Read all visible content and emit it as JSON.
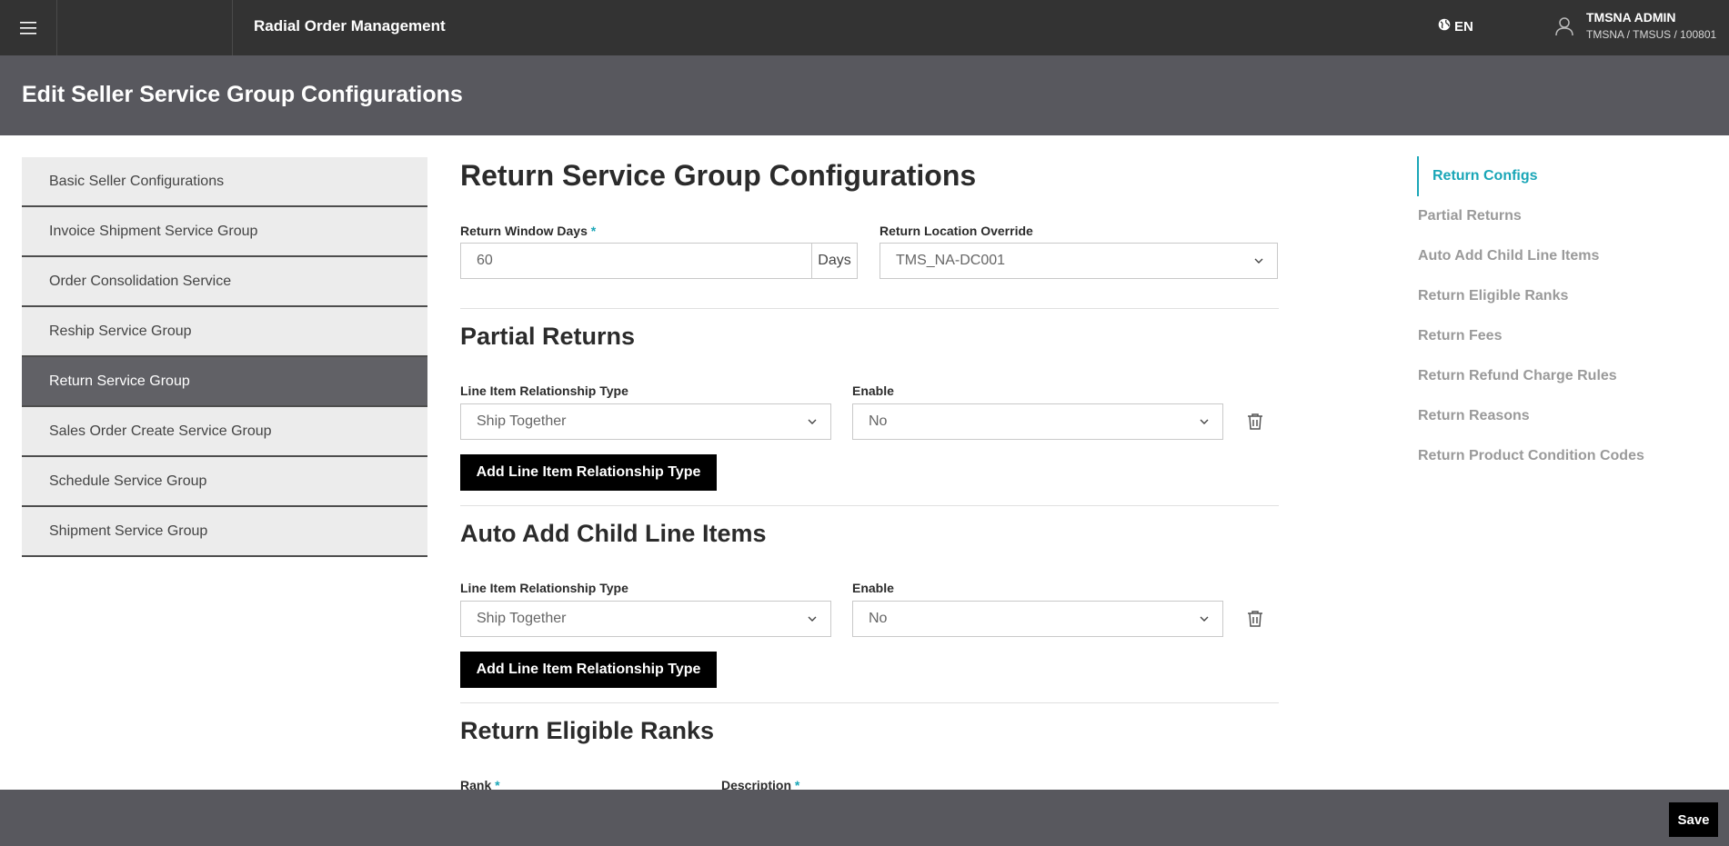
{
  "topbar": {
    "app_title": "Radial Order Management",
    "language": "EN",
    "user_name": "TMSNA ADMIN",
    "user_org": "TMSNA / TMSUS / 100801"
  },
  "page": {
    "title": "Edit Seller Service Group Configurations"
  },
  "leftnav": {
    "items": [
      {
        "label": "Basic Seller Configurations"
      },
      {
        "label": "Invoice Shipment Service Group"
      },
      {
        "label": "Order Consolidation Service"
      },
      {
        "label": "Reship Service Group"
      },
      {
        "label": "Return Service Group",
        "active": true
      },
      {
        "label": "Sales Order Create Service Group"
      },
      {
        "label": "Schedule Service Group"
      },
      {
        "label": "Shipment Service Group"
      }
    ]
  },
  "main": {
    "title": "Return Service Group Configurations",
    "return_window": {
      "label": "Return Window Days",
      "required_mark": "*",
      "value": "60",
      "unit": "Days"
    },
    "return_location": {
      "label": "Return Location Override",
      "value": "TMS_NA-DC001"
    },
    "partial_returns": {
      "title": "Partial Returns",
      "relationship_label": "Line Item Relationship Type",
      "relationship_value": "Ship Together",
      "enable_label": "Enable",
      "enable_value": "No",
      "add_button": "Add Line Item Relationship Type"
    },
    "auto_add": {
      "title": "Auto Add Child Line Items",
      "relationship_label": "Line Item Relationship Type",
      "relationship_value": "Ship Together",
      "enable_label": "Enable",
      "enable_value": "No",
      "add_button": "Add Line Item Relationship Type"
    },
    "eligible_ranks": {
      "title": "Return Eligible Ranks",
      "rank_label": "Rank",
      "description_label": "Description",
      "required_mark": "*"
    }
  },
  "toc": {
    "items": [
      {
        "label": "Return Configs",
        "active": true
      },
      {
        "label": "Partial Returns"
      },
      {
        "label": "Auto Add Child Line Items"
      },
      {
        "label": "Return Eligible Ranks"
      },
      {
        "label": "Return Fees"
      },
      {
        "label": "Return Refund Charge Rules"
      },
      {
        "label": "Return Reasons"
      },
      {
        "label": "Return Product Condition Codes"
      }
    ]
  },
  "footer": {
    "save_label": "Save"
  },
  "colors": {
    "topbar": "#333333",
    "header": "#58585e",
    "accent": "#1aa6b7",
    "nav_active": "#616166"
  }
}
